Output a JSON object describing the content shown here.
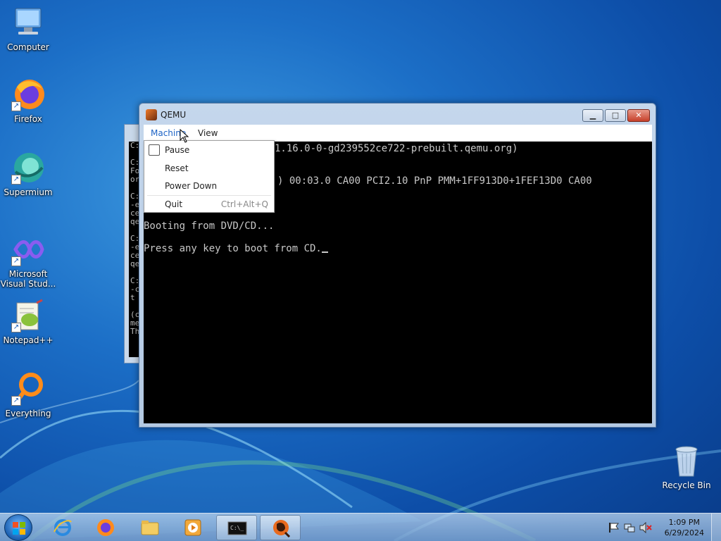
{
  "desktop": {
    "icons": [
      {
        "label": "Computer"
      },
      {
        "label": "Firefox"
      },
      {
        "label": "Supermium"
      },
      {
        "label": "Microsoft Visual Stud..."
      },
      {
        "label": "Notepad++"
      },
      {
        "label": "Everything"
      }
    ],
    "recycle_bin": "Recycle Bin"
  },
  "background_window": {
    "lines": [
      "C:",
      "",
      "C:",
      "Fo",
      "or",
      "",
      "C:",
      "-e",
      "ce",
      "qe",
      "",
      "C:",
      "-e",
      "ce",
      "qe",
      "",
      "C:",
      "-c",
      "t",
      "",
      "(c",
      "me",
      "Th"
    ]
  },
  "qemu": {
    "title": "QEMU",
    "menu": [
      "Machine",
      "View"
    ],
    "screen_lines": [
      "1.16.0-0-gd239552ce722-prebuilt.qemu.org)",
      ") 00:03.0 CA00 PCI2.10 PnP PMM+1FF913D0+1FEF13D0 CA00",
      "Booting from DVD/CD...",
      "Press any key to boot from CD."
    ]
  },
  "machine_menu": {
    "items": [
      {
        "label": "Pause",
        "checkbox": true,
        "checked": false
      },
      {
        "label": "Reset"
      },
      {
        "label": "Power Down"
      },
      {
        "label": "Quit",
        "shortcut": "Ctrl+Alt+Q"
      }
    ]
  },
  "taskbar": {
    "pinned": [
      "internet-explorer",
      "firefox",
      "file-explorer",
      "media-player",
      "command-prompt",
      "qemu"
    ],
    "active": "qemu",
    "clock": {
      "time": "1:09 PM",
      "date": "6/29/2024"
    }
  },
  "colors": {
    "accent": "#1d63c5",
    "desktop": "#1c6fc7"
  }
}
